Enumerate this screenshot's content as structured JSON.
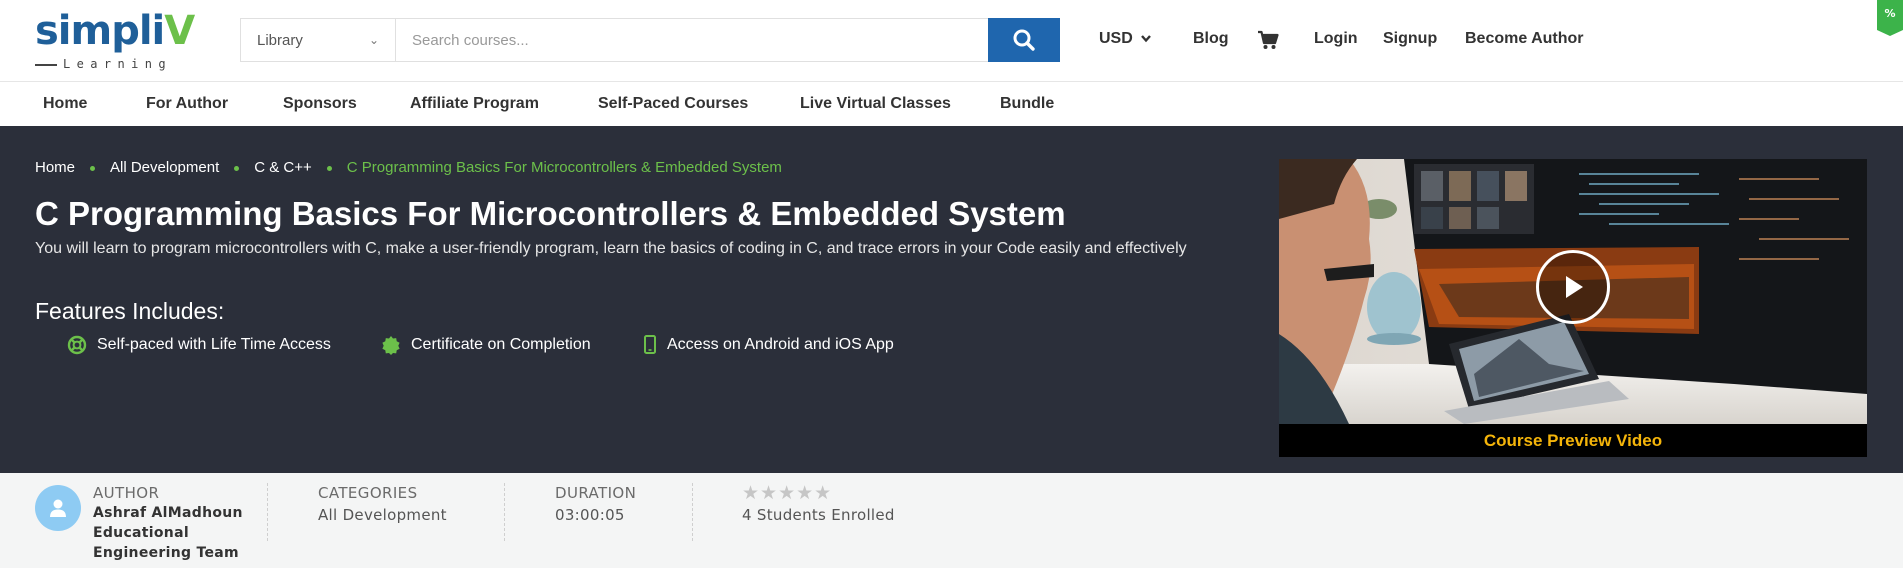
{
  "brand": {
    "name_main": "simpli",
    "name_accent": "V",
    "tagline": "Learning",
    "primary_color": "#1f5f99",
    "accent_color": "#6cc04a"
  },
  "search": {
    "category_selected": "Library",
    "placeholder": "Search courses..."
  },
  "header": {
    "currency": "USD",
    "links": {
      "blog": "Blog",
      "login": "Login",
      "signup": "Signup",
      "become_author": "Become Author"
    },
    "corner_badge": "%"
  },
  "nav": [
    "Home",
    "For Author",
    "Sponsors",
    "Affiliate Program",
    "Self-Paced Courses",
    "Live Virtual Classes",
    "Bundle"
  ],
  "hero": {
    "breadcrumb": [
      "Home",
      "All Development",
      "C & C++",
      "C Programming Basics For Microcontrollers & Embedded System"
    ],
    "title": "C Programming Basics For Microcontrollers & Embedded System",
    "description": "You will learn to program microcontrollers with C, make a user-friendly program, learn the basics of coding in C, and trace errors in your Code easily and effectively",
    "features_title": "Features Includes:",
    "features": [
      {
        "icon": "lifebuoy-icon",
        "label": "Self-paced with Life Time Access"
      },
      {
        "icon": "certificate-badge-icon",
        "label": "Certificate on Completion"
      },
      {
        "icon": "mobile-phone-icon",
        "label": "Access on Android and iOS App"
      }
    ],
    "video_caption": "Course Preview Video"
  },
  "info": {
    "author": {
      "label": "AUTHOR",
      "name": "Ashraf AlMadhoun Educational Engineering Team"
    },
    "categories": {
      "label": "CATEGORIES",
      "value": "All Development"
    },
    "duration": {
      "label": "DURATION",
      "value": "03:00:05"
    },
    "rating": {
      "stars": 0,
      "max": 5,
      "enrolled": "4 Students Enrolled"
    }
  }
}
